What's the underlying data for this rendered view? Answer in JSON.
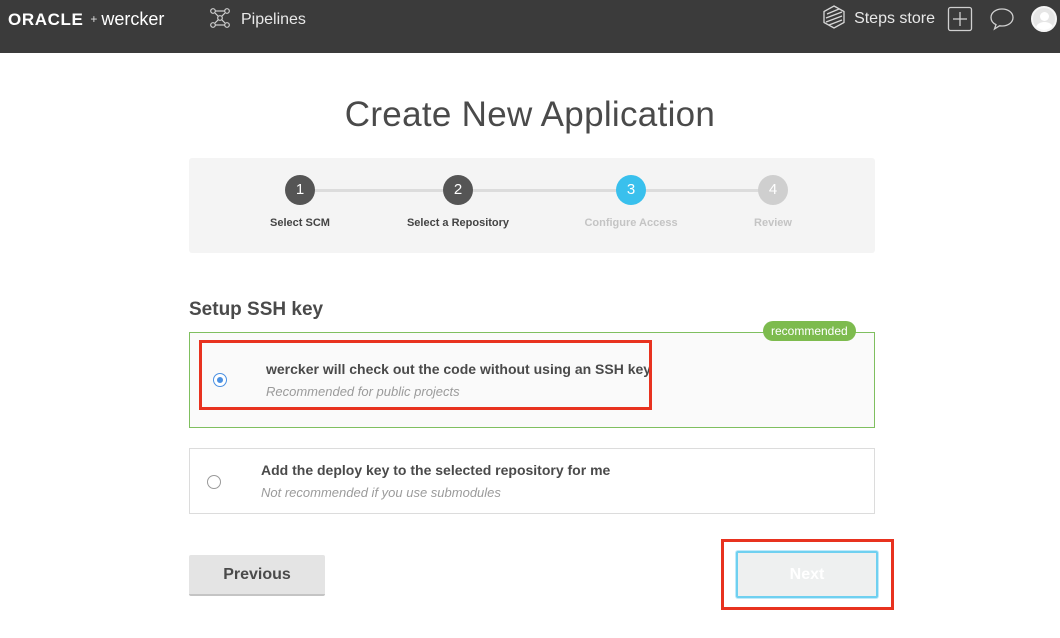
{
  "nav": {
    "brand_oracle": "ORACLE",
    "brand_plus": "+",
    "brand_wercker": "wercker",
    "pipelines_label": "Pipelines",
    "steps_store_label": "Steps store"
  },
  "page": {
    "title": "Create New Application"
  },
  "stepper": {
    "steps": [
      {
        "number": "1",
        "label": "Select SCM",
        "state": "done"
      },
      {
        "number": "2",
        "label": "Select a Repository",
        "state": "done"
      },
      {
        "number": "3",
        "label": "Configure Access",
        "state": "active"
      },
      {
        "number": "4",
        "label": "Review",
        "state": "todo"
      }
    ]
  },
  "ssh": {
    "section_title": "Setup SSH key",
    "options": [
      {
        "title": "wercker will check out the code without using an SSH key",
        "subtitle": "Recommended for public projects",
        "selected": true,
        "badge": "recommended"
      },
      {
        "title": "Add the deploy key to the selected repository for me",
        "subtitle": "Not recommended if you use submodules",
        "selected": false
      }
    ]
  },
  "buttons": {
    "previous": "Previous",
    "next": "Next"
  },
  "colors": {
    "topbar": "#3b3b3b",
    "step_done": "#555555",
    "step_active": "#39c0ed",
    "step_todo": "#cfcfcf",
    "recommended_badge": "#7dbb4e",
    "annotation_red": "#e8321f"
  }
}
